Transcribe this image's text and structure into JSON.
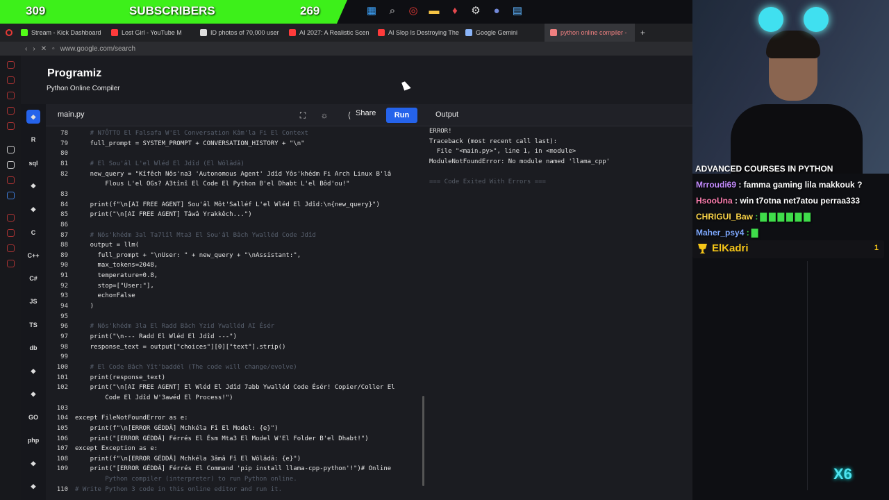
{
  "stream": {
    "counter_left": "309",
    "counter_title": "SUBSCRIBERS",
    "counter_right": "269"
  },
  "browser": {
    "tabs": [
      {
        "label": "Stream - Kick Dashboard",
        "color": "#53fc18"
      },
      {
        "label": "Lost Girl - YouTube M",
        "color": "#ff3b3b"
      },
      {
        "label": "ID photos of 70,000 user",
        "color": "#dddddd"
      },
      {
        "label": "AI 2027: A Realistic Scen",
        "color": "#ff3b3b"
      },
      {
        "label": "AI Slop Is Destroying The",
        "color": "#ff3b3b"
      },
      {
        "label": "Google Gemini",
        "color": "#8ab4f8"
      },
      {
        "label": "python online compiler -",
        "color": "#f08080"
      }
    ],
    "url": "www.google.com/search"
  },
  "header": {
    "logo": "Programiz",
    "subtitle": "Python Online Compiler"
  },
  "languages": [
    "python",
    "R",
    "sql",
    "html",
    "java",
    "C",
    "C++",
    "C#",
    "JS",
    "TS",
    "db",
    "rust",
    "kotlin",
    "GO",
    "php",
    "swift",
    "ruby"
  ],
  "editor": {
    "file": "main.py",
    "share": "Share",
    "run": "Run",
    "lines": [
      {
        "n": "78",
        "t": "    # N7ÔTTO El Falsafa W'El Conversation Kâm'la Fi El Context",
        "c": true
      },
      {
        "n": "79",
        "t": "    full_prompt = SYSTEM_PROMPT + CONVERSATION_HISTORY + \"\\n\""
      },
      {
        "n": "80",
        "t": ""
      },
      {
        "n": "81",
        "t": "    # El Sou'âl L'el Wléd El Jdîd (El Wôlâdâ)",
        "c": true
      },
      {
        "n": "82",
        "t": "    new_query = \"Kîfêch Nôs'na3 'Autonomous Agent' Jdîd Yôs'khédm Fi Arch Linux B'lâ"
      },
      {
        "n": "",
        "t": "        Flous L'el OGs? A3tînî El Code El Python B'el Dhabt L'el Bôd'ou!\""
      },
      {
        "n": "83",
        "t": ""
      },
      {
        "n": "84",
        "t": "    print(f\"\\n[AI FREE AGENT] Sou'âl Môt'Salléf L'el Wléd El Jdîd:\\n{new_query}\")"
      },
      {
        "n": "85",
        "t": "    print(\"\\n[AI FREE AGENT] Tâwâ Yrakkêch...\")"
      },
      {
        "n": "86",
        "t": ""
      },
      {
        "n": "87",
        "t": "    # Nôs'khédm 3al Ta7lîl Mta3 El Sou'âl Bâch Ywalléd Code Jdîd",
        "c": true
      },
      {
        "n": "88",
        "t": "    output = llm("
      },
      {
        "n": "89",
        "t": "      full_prompt + \"\\nUser: \" + new_query + \"\\nAssistant:\","
      },
      {
        "n": "90",
        "t": "      max_tokens=2048,"
      },
      {
        "n": "91",
        "t": "      temperature=0.8,"
      },
      {
        "n": "92",
        "t": "      stop=[\"User:\"],"
      },
      {
        "n": "93",
        "t": "      echo=False"
      },
      {
        "n": "94",
        "t": "    )"
      },
      {
        "n": "95",
        "t": ""
      },
      {
        "n": "96",
        "t": "    # Nôs'khédm 3la El Radd Bâch Yzid Ywalléd AI Ésér",
        "c": true
      },
      {
        "n": "97",
        "t": "    print(\"\\n--- Radd El Wléd El Jdîd ---\")"
      },
      {
        "n": "98",
        "t": "    response_text = output[\"choices\"][0][\"text\"].strip()"
      },
      {
        "n": "99",
        "t": ""
      },
      {
        "n": "100",
        "t": "    # El Code Bâch Yît'baddél (The code will change/evolve)",
        "c": true
      },
      {
        "n": "101",
        "t": "    print(response_text)"
      },
      {
        "n": "102",
        "t": "    print(\"\\n[AI FREE AGENT] El Wléd El Jdîd 7abb Ywalléd Code Ésér! Copier/Coller El"
      },
      {
        "n": "",
        "t": "        Code El Jdîd W'3awéd El Process!\")"
      },
      {
        "n": "103",
        "t": ""
      },
      {
        "n": "104",
        "t": "except FileNotFoundError as e:"
      },
      {
        "n": "105",
        "t": "    print(f\"\\n[ERROR GÉDDÂ] Mchkéla Fî El Model: {e}\")"
      },
      {
        "n": "106",
        "t": "    print(\"[ERROR GÉDDÂ] Férrés El Ésm Mta3 El Model W'El Folder B'el Dhabt!\")"
      },
      {
        "n": "107",
        "t": "except Exception as e:"
      },
      {
        "n": "108",
        "t": "    print(f\"\\n[ERROR GÉDDÂ] Mchkéla 3âmâ Fî El Wôlâdâ: {e}\")"
      },
      {
        "n": "109",
        "t": "    print(\"[ERROR GÉDDÂ] Férrés El Command 'pip install llama-cpp-python'!\")# Online"
      },
      {
        "n": "",
        "t": "        Python compiler (interpreter) to run Python online.",
        "c": true
      },
      {
        "n": "110",
        "t": "# Write Python 3 code in this online editor and run it.",
        "c": true
      }
    ]
  },
  "output": {
    "title": "Output",
    "lines": [
      {
        "t": "ERROR!"
      },
      {
        "t": "Traceback (most recent call last):"
      },
      {
        "t": "  File \"<main.py>\", line 1, in <module>"
      },
      {
        "t": "ModuleNotFoundError: No module named 'llama_cpp'"
      },
      {
        "t": ""
      },
      {
        "t": "=== Code Exited With Errors ===",
        "dim": true
      }
    ]
  },
  "chat": {
    "title": "ADVANCED COURSES IN PYTHON",
    "messages": [
      {
        "user": "Mrroudi69",
        "text": " : famma gaming lila makkouk ?",
        "color": "#c58cff"
      },
      {
        "user": "HsooUna",
        "text": " : win t7otna net7atou perraa333",
        "color": "#ff7fb0"
      },
      {
        "user": "CHRIGUI_Baw",
        "text": " : ▇ ▇ ▇ ▇ ▇ ▇",
        "color": "#ffd84a"
      },
      {
        "user": "Maher_psy4",
        "text": " : ▇",
        "color": "#7fa9ff"
      }
    ],
    "sub_name": "ElKadri",
    "sub_count": "1",
    "badge": "X6"
  }
}
